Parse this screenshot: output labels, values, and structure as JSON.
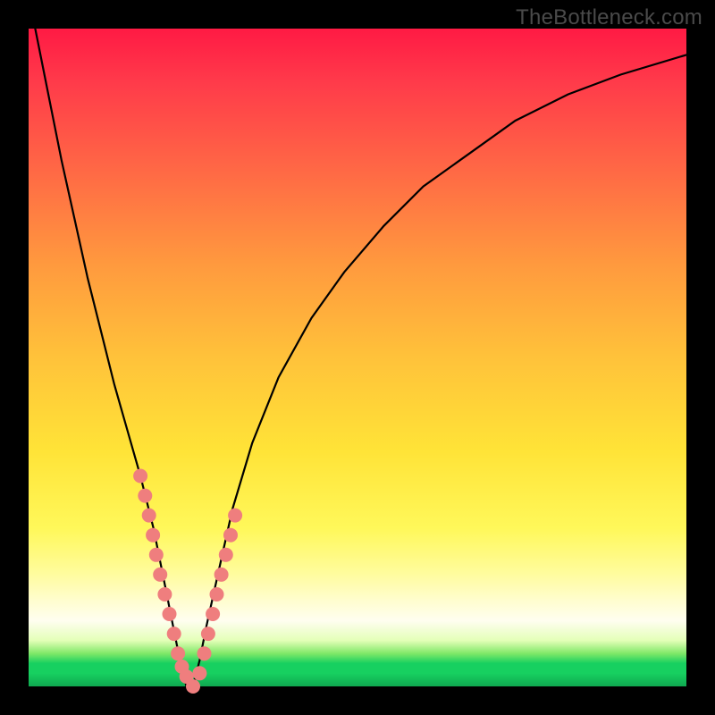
{
  "watermark": "TheBottleneck.com",
  "chart_data": {
    "type": "line",
    "title": "",
    "xlabel": "",
    "ylabel": "",
    "xlim": [
      0,
      100
    ],
    "ylim": [
      0,
      100
    ],
    "series": [
      {
        "name": "bottleneck-curve",
        "x": [
          1,
          3,
          5,
          7,
          9,
          11,
          13,
          15,
          17,
          19,
          20,
          21,
          22,
          23,
          24,
          25,
          26,
          27,
          29,
          31,
          34,
          38,
          43,
          48,
          54,
          60,
          67,
          74,
          82,
          90,
          100
        ],
        "y": [
          100,
          90,
          80,
          71,
          62,
          54,
          46,
          39,
          32,
          24,
          19,
          14,
          9,
          4,
          0,
          0,
          4,
          9,
          18,
          27,
          37,
          47,
          56,
          63,
          70,
          76,
          81,
          86,
          90,
          93,
          96
        ]
      }
    ],
    "markers": {
      "name": "highlighted-points",
      "color": "#ef7e7e",
      "x": [
        17,
        17.7,
        18.3,
        18.9,
        19.4,
        20,
        20.7,
        21.4,
        22.1,
        22.7,
        23.3,
        24,
        25,
        26,
        26.7,
        27.3,
        28,
        28.6,
        29.3,
        30,
        30.7,
        31.4
      ],
      "y": [
        32,
        29,
        26,
        23,
        20,
        17,
        14,
        11,
        8,
        5,
        3,
        1.5,
        0,
        2,
        5,
        8,
        11,
        14,
        17,
        20,
        23,
        26
      ]
    },
    "gradient_stops": [
      {
        "pos": 0.0,
        "color": "#ff1a44"
      },
      {
        "pos": 0.5,
        "color": "#ffc23a"
      },
      {
        "pos": 0.8,
        "color": "#fff85a"
      },
      {
        "pos": 0.93,
        "color": "#e4ffb8"
      },
      {
        "pos": 0.97,
        "color": "#17d060"
      },
      {
        "pos": 1.0,
        "color": "#0fa850"
      }
    ]
  }
}
